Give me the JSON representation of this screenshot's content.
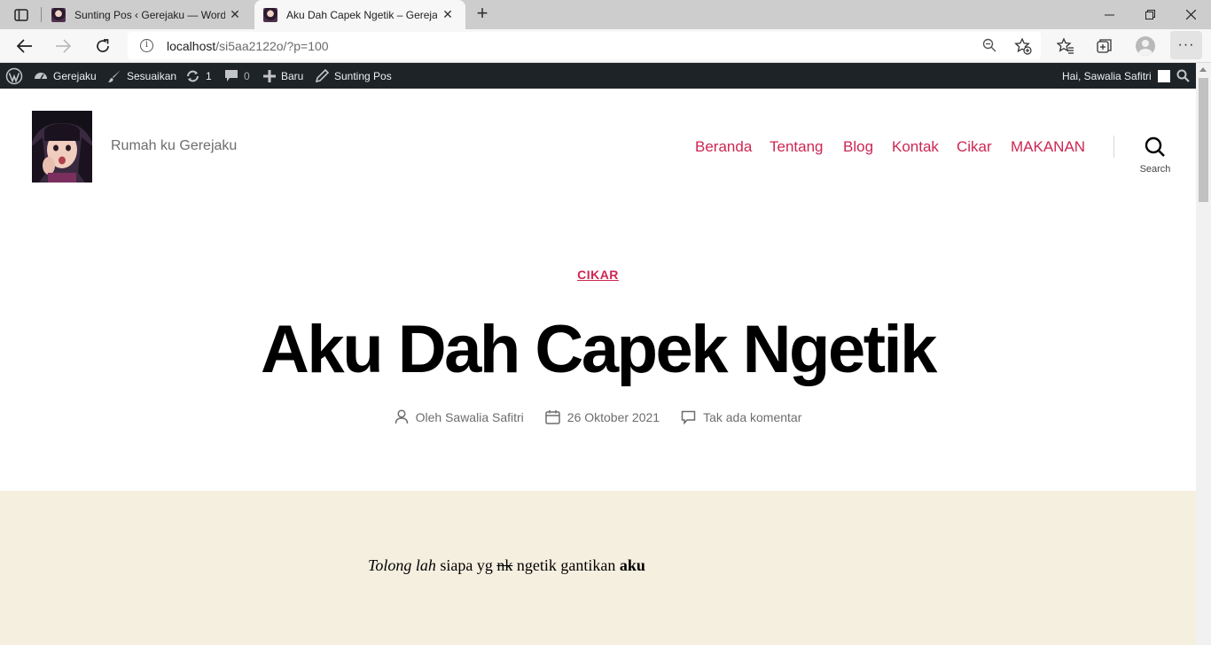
{
  "browser": {
    "tabs": [
      {
        "title": "Sunting Pos ‹ Gerejaku — WordPress",
        "active": false
      },
      {
        "title": "Aku Dah Capek Ngetik – Gerejaku",
        "active": true
      }
    ],
    "close_glyph": "✕",
    "new_tab_glyph": "+",
    "url_host": "localhost",
    "url_path": "/si5aa2122o/?p=100",
    "more_glyph": "···"
  },
  "admin_bar": {
    "site_name": "Gerejaku",
    "customize": "Sesuaikan",
    "updates_count": "1",
    "comments_count": "0",
    "new_label": "Baru",
    "edit_post": "Sunting Pos",
    "greeting": "Hai, Sawalia Safitri"
  },
  "site": {
    "description": "Rumah ku Gerejaku",
    "menu": [
      "Beranda",
      "Tentang",
      "Blog",
      "Kontak",
      "Cikar",
      "MAKANAN"
    ],
    "search_label": "Search"
  },
  "post": {
    "category": "CIKAR",
    "title": "Aku Dah Capek Ngetik",
    "author": "Oleh Sawalia Safitri",
    "date": "26 Oktober 2021",
    "comments": "Tak ada komentar",
    "content": {
      "italic": "Tolong lah",
      "text1": " siapa yg ",
      "strike": "nk",
      "text2": " ngetik gantikan ",
      "bold": "aku"
    }
  },
  "colors": {
    "accent": "#cd2653",
    "admin_bar_bg": "#1d2327",
    "content_bg": "#f5efe0",
    "tabstrip_bg": "#cdcdcd"
  },
  "icons": [
    "sidebar-icon",
    "back-icon",
    "forward-icon",
    "reload-icon",
    "info-icon",
    "zoom-out-icon",
    "add-favorite-icon",
    "favorites-icon",
    "collections-icon",
    "profile-icon",
    "wordpress-icon",
    "dashboard-icon",
    "brush-icon",
    "update-icon",
    "comment-icon",
    "plus-icon",
    "pencil-icon",
    "search-icon",
    "user-icon",
    "calendar-icon",
    "comment-bubble-icon"
  ]
}
